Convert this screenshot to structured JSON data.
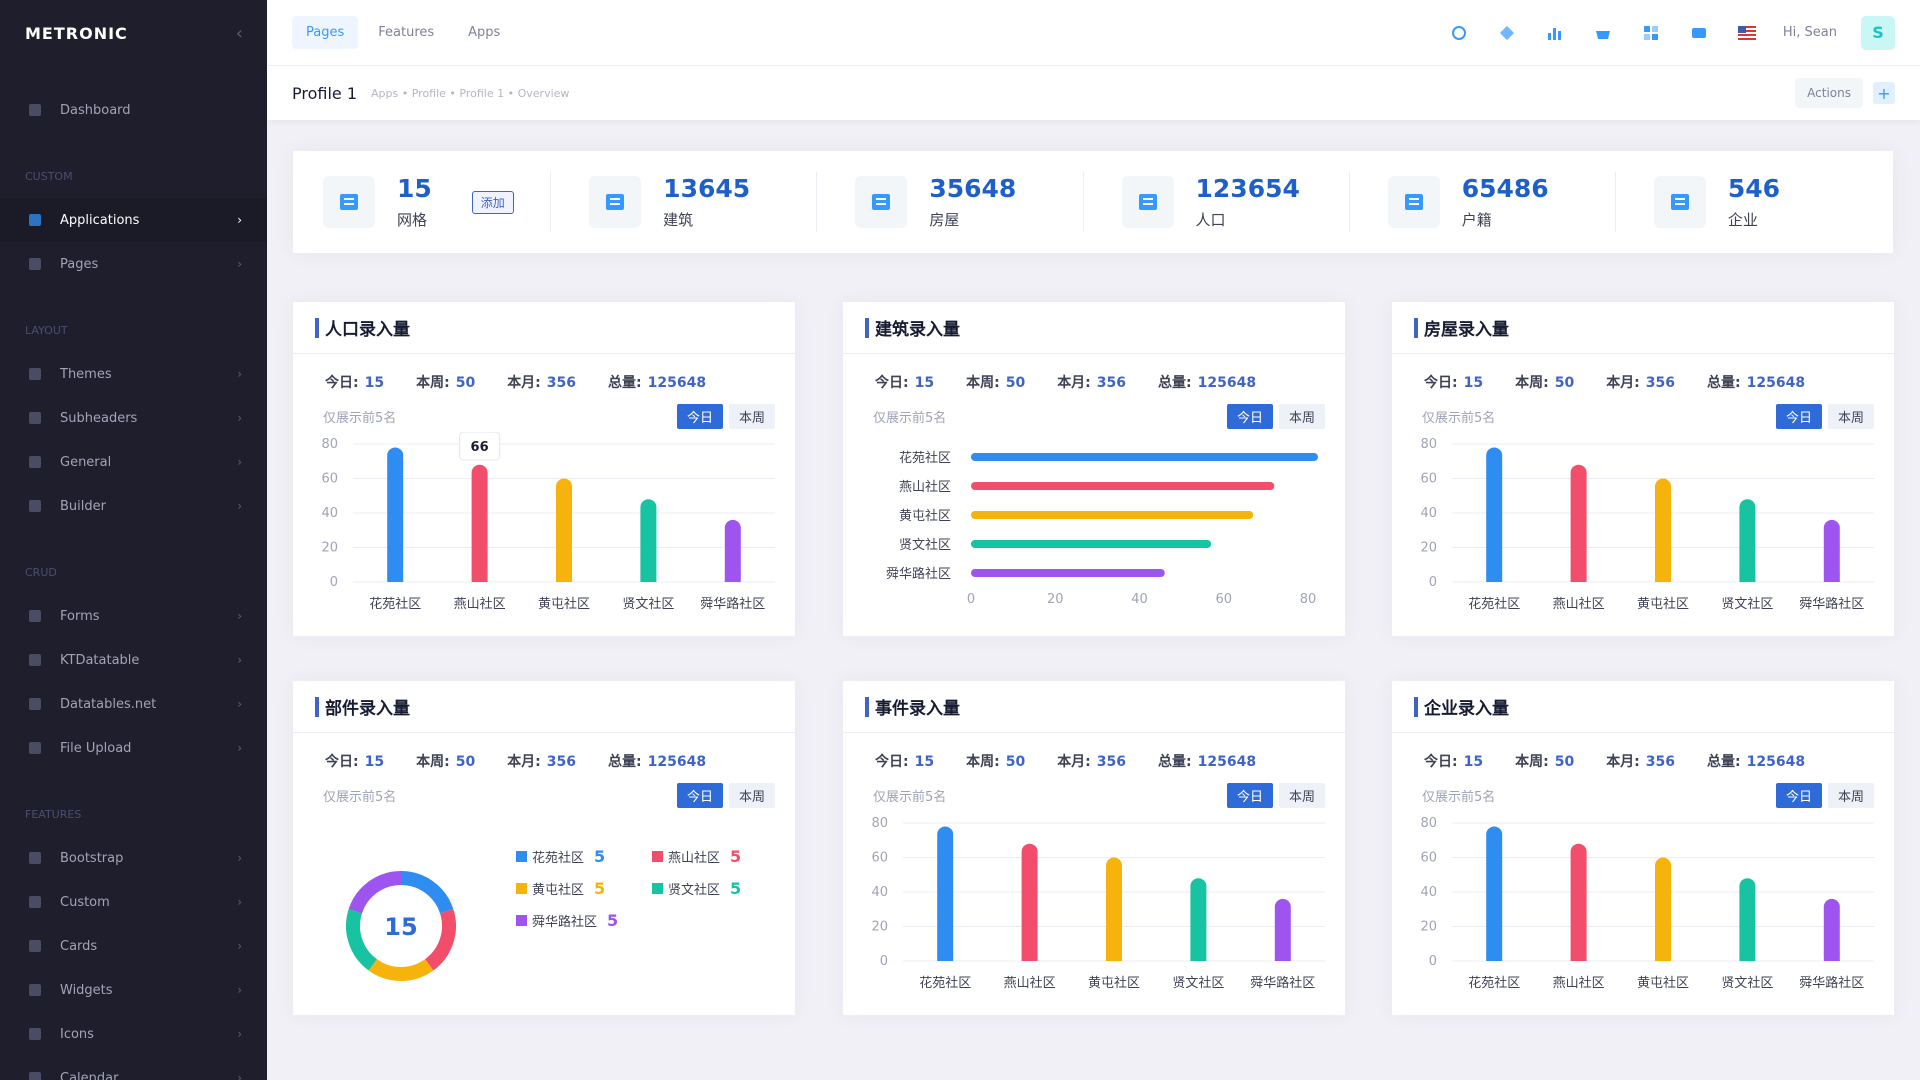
{
  "brand": {
    "logo": "METRONIC",
    "collapse_icon": "chevron-left-icon"
  },
  "sidebar": {
    "items": [
      {
        "label": "Dashboard",
        "icon": "layers-icon"
      },
      {
        "section": "CUSTOM"
      },
      {
        "label": "Applications",
        "icon": "grid-icon",
        "active": true
      },
      {
        "label": "Pages",
        "icon": "pages-icon"
      },
      {
        "section": "LAYOUT"
      },
      {
        "label": "Themes",
        "icon": "palette-icon"
      },
      {
        "label": "Subheaders",
        "icon": "subheader-icon"
      },
      {
        "label": "General",
        "icon": "general-icon"
      },
      {
        "label": "Builder",
        "icon": "builder-icon"
      },
      {
        "section": "CRUD"
      },
      {
        "label": "Forms",
        "icon": "forms-icon"
      },
      {
        "label": "KTDatatable",
        "icon": "table-icon"
      },
      {
        "label": "Datatables.net",
        "icon": "table-icon"
      },
      {
        "label": "File Upload",
        "icon": "upload-icon"
      },
      {
        "section": "FEATURES"
      },
      {
        "label": "Bootstrap",
        "icon": "bootstrap-icon"
      },
      {
        "label": "Custom",
        "icon": "custom-icon"
      },
      {
        "label": "Cards",
        "icon": "cards-icon"
      },
      {
        "label": "Widgets",
        "icon": "widgets-icon"
      },
      {
        "label": "Icons",
        "icon": "icons-icon"
      },
      {
        "label": "Calendar",
        "icon": "calendar-icon"
      }
    ]
  },
  "topbar": {
    "tabs": [
      {
        "label": "Pages",
        "active": true
      },
      {
        "label": "Features"
      },
      {
        "label": "Apps"
      }
    ],
    "greeting": "Hi, Sean",
    "avatar": "S"
  },
  "subheader": {
    "title": "Profile 1",
    "breadcrumbs": [
      "Apps",
      "Profile",
      "Profile 1",
      "Overview"
    ],
    "actions": "Actions"
  },
  "stats": [
    {
      "value": "15",
      "label": "网格",
      "icon": "grid-network-icon",
      "add": "添加"
    },
    {
      "value": "13645",
      "label": "建筑",
      "icon": "building-icon"
    },
    {
      "value": "35648",
      "label": "房屋",
      "icon": "home-icon"
    },
    {
      "value": "123654",
      "label": "人口",
      "icon": "people-icon"
    },
    {
      "value": "65486",
      "label": "户籍",
      "icon": "id-card-icon"
    },
    {
      "value": "546",
      "label": "企业",
      "icon": "bank-icon"
    }
  ],
  "card_common": {
    "today_label": "今日:",
    "today": "15",
    "week_label": "本周:",
    "week": "50",
    "month_label": "本月:",
    "month": "356",
    "total_label": "总量:",
    "total": "125648",
    "note": "仅展示前5名",
    "btn_today": "今日",
    "btn_week": "本周"
  },
  "cards": [
    {
      "title": "人口录入量"
    },
    {
      "title": "建筑录入量"
    },
    {
      "title": "房屋录入量"
    },
    {
      "title": "部件录入量"
    },
    {
      "title": "事件录入量"
    },
    {
      "title": "企业录入量"
    }
  ],
  "chart_data": [
    {
      "type": "bar",
      "categories": [
        "花苑社区",
        "燕山社区",
        "黄屯社区",
        "贤文社区",
        "舜华路社区"
      ],
      "values": [
        78,
        68,
        60,
        48,
        36
      ],
      "ylim": [
        0,
        80
      ],
      "yticks": [
        0,
        20,
        40,
        60,
        80
      ],
      "tooltip": "66"
    },
    {
      "type": "bar",
      "orientation": "horizontal",
      "categories": [
        "花苑社区",
        "燕山社区",
        "黄屯社区",
        "贤文社区",
        "舜华路社区"
      ],
      "values": [
        84,
        72,
        67,
        57,
        46
      ],
      "xlim": [
        0,
        80
      ],
      "xticks": [
        0,
        20,
        40,
        60,
        80
      ]
    },
    {
      "type": "bar",
      "categories": [
        "花苑社区",
        "燕山社区",
        "黄屯社区",
        "贤文社区",
        "舜华路社区"
      ],
      "values": [
        78,
        68,
        60,
        48,
        36
      ],
      "ylim": [
        0,
        80
      ],
      "yticks": [
        0,
        20,
        40,
        60,
        80
      ]
    },
    {
      "type": "pie",
      "center_label": "15",
      "categories": [
        "花苑社区",
        "燕山社区",
        "黄屯社区",
        "贤文社区",
        "舜华路社区"
      ],
      "values": [
        5,
        5,
        5,
        5,
        5
      ]
    },
    {
      "type": "bar",
      "categories": [
        "花苑社区",
        "燕山社区",
        "黄屯社区",
        "贤文社区",
        "舜华路社区"
      ],
      "values": [
        78,
        68,
        60,
        48,
        36
      ],
      "ylim": [
        0,
        80
      ],
      "yticks": [
        0,
        20,
        40,
        60,
        80
      ]
    },
    {
      "type": "bar",
      "categories": [
        "花苑社区",
        "燕山社区",
        "黄屯社区",
        "贤文社区",
        "舜华路社区"
      ],
      "values": [
        78,
        68,
        60,
        48,
        36
      ],
      "ylim": [
        0,
        80
      ],
      "yticks": [
        0,
        20,
        40,
        60,
        80
      ]
    }
  ],
  "colors": {
    "blue": "#2f8cf0",
    "red": "#f24e6b",
    "yellow": "#f5b30c",
    "green": "#17c3a0",
    "purple": "#9e55f0",
    "accent": "#3f64c6"
  }
}
